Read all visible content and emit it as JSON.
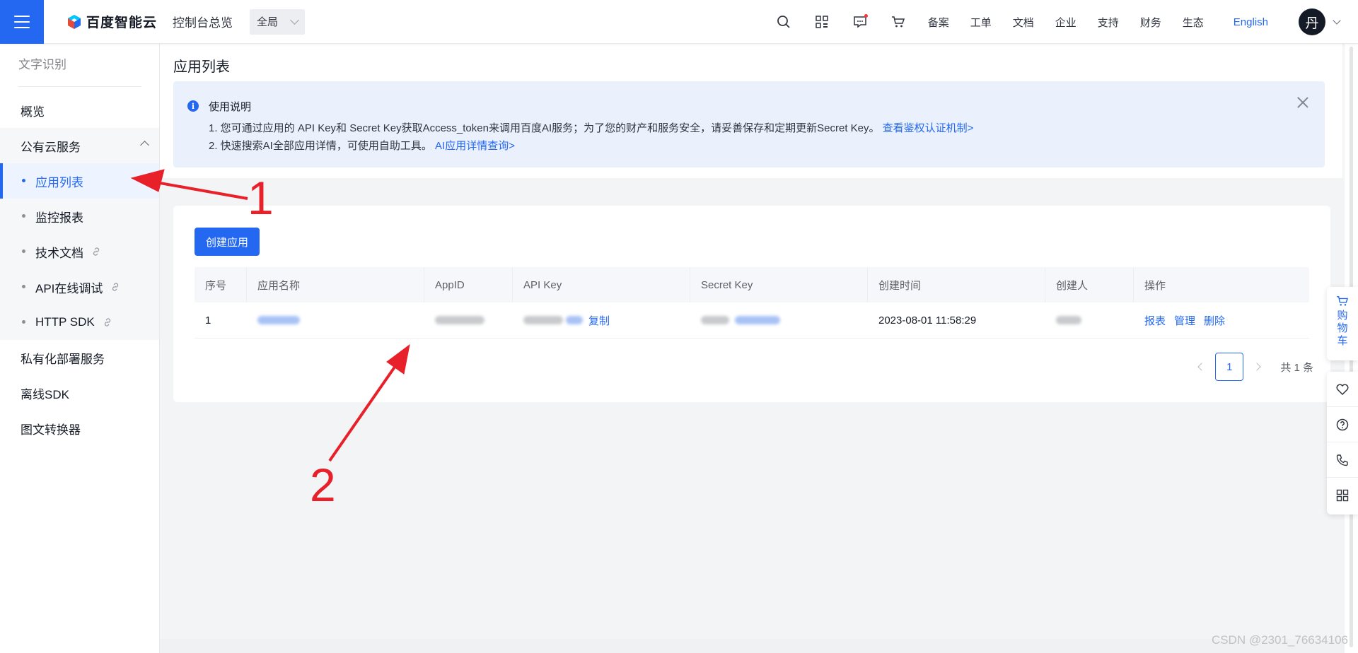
{
  "header": {
    "brand": "百度智能云",
    "console": "控制台总览",
    "region": "全局",
    "nav": [
      "备案",
      "工单",
      "文档",
      "企业",
      "支持",
      "财务",
      "生态"
    ],
    "language": "English",
    "avatar_initial": "丹",
    "icons": [
      "search-icon",
      "grid-icon",
      "message-icon",
      "cart-icon"
    ]
  },
  "sidebar": {
    "title": "文字识别",
    "items": [
      {
        "label": "概览"
      },
      {
        "label": "公有云服务",
        "expanded": true
      },
      {
        "label": "应用列表",
        "active": true
      },
      {
        "label": "监控报表"
      },
      {
        "label": "技术文档",
        "external": true
      },
      {
        "label": "API在线调试",
        "external": true
      },
      {
        "label": "HTTP SDK",
        "external": true
      },
      {
        "label": "私有化部署服务"
      },
      {
        "label": "离线SDK"
      },
      {
        "label": "图文转换器"
      }
    ]
  },
  "page": {
    "title": "应用列表",
    "notice": {
      "title": "使用说明",
      "line1": "1. 您可通过应用的 API Key和 Secret Key获取Access_token来调用百度AI服务；为了您的财产和服务安全，请妥善保存和定期更新Secret Key。",
      "line1_link": "查看鉴权认证机制>",
      "line2": "2. 快速搜索AI全部应用详情，可使用自助工具。",
      "line2_link": "AI应用详情查询>"
    },
    "create_button": "创建应用",
    "table": {
      "columns": [
        "序号",
        "应用名称",
        "AppID",
        "API Key",
        "Secret Key",
        "创建时间",
        "创建人",
        "操作"
      ],
      "rows": [
        {
          "index": "1",
          "created": "2023-08-01 11:58:29",
          "copy": "复制",
          "actions": [
            "报表",
            "管理",
            "删除"
          ]
        }
      ]
    },
    "pagination": {
      "current": "1",
      "total": "共 1 条"
    }
  },
  "float": {
    "cart_label": "购物车",
    "tools": [
      "heart-icon",
      "help-icon",
      "phone-icon",
      "apps-icon"
    ]
  },
  "annotations": {
    "one": "1",
    "two": "2",
    "color": "#e8202a"
  },
  "watermark": "CSDN @2301_76634106",
  "colors": {
    "primary": "#2468f2",
    "notice_bg": "#eaf1fd"
  }
}
